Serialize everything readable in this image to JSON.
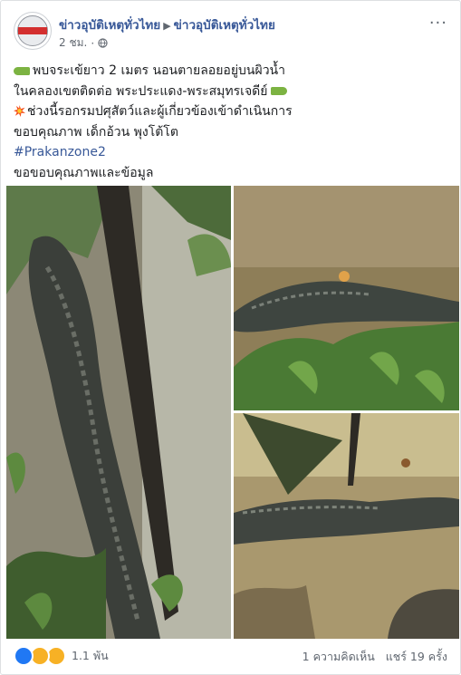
{
  "post": {
    "page_name": "ข่าวอุบัติเหตุทั่วไทย",
    "shared_to": "ข่าวอุบัติเหตุทั่วไทย",
    "avatar_text": "ข่าวอุบัติเหตุ",
    "time": "2 ชม.",
    "privacy_icon": "globe-icon",
    "lines": {
      "l1": "พบจระเข้ยาว 2 เมตร นอนตายลอยอยู่บนผิวน้ำ",
      "l2": "ในคลองเขตติดต่อ พระประแดง-พระสมุทรเจดีย์",
      "l3": "ช่วงนี้รอกรมปศุสัตว์และผู้เกี่ยวข้องเข้าดำเนินการ",
      "l4": "ขอบคุณภาพ เด็กอ้วน พุงโต้โต",
      "hashtag": "#Prakanzone2",
      "l6": "ขอขอบคุณภาพและข้อมูล"
    }
  },
  "photos": {
    "count": 3,
    "subject": "crocodile"
  },
  "footer": {
    "reactions_icons": [
      "like",
      "wow",
      "sad"
    ],
    "reactions_count": "1.1 พัน",
    "comments": "1 ความคิดเห็น",
    "shares": "แชร์ 19 ครั้ง"
  },
  "colors": {
    "link": "#385898",
    "text": "#1c1e21",
    "meta": "#616770",
    "like_blue": "#2078f4",
    "emoji_yellow": "#f7b125"
  }
}
